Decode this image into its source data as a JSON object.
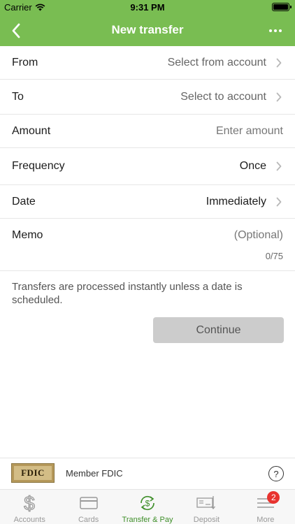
{
  "status_bar": {
    "carrier": "Carrier",
    "time": "9:31 PM"
  },
  "nav": {
    "title": "New transfer"
  },
  "form": {
    "from": {
      "label": "From",
      "value": "Select from account"
    },
    "to": {
      "label": "To",
      "value": "Select to account"
    },
    "amount": {
      "label": "Amount",
      "placeholder": "Enter amount"
    },
    "frequency": {
      "label": "Frequency",
      "value": "Once"
    },
    "date": {
      "label": "Date",
      "value": "Immediately"
    },
    "memo": {
      "label": "Memo",
      "placeholder": "(Optional)",
      "counter": "0/75"
    }
  },
  "note": "Transfers are processed instantly unless a date is scheduled.",
  "continue_label": "Continue",
  "footer": {
    "fdic_logo": "FDIC",
    "member_text": "Member FDIC",
    "help_label": "?"
  },
  "tabs": [
    {
      "label": "Accounts",
      "icon": "dollar-icon",
      "active": false
    },
    {
      "label": "Cards",
      "icon": "card-icon",
      "active": false
    },
    {
      "label": "Transfer & Pay",
      "icon": "transfer-pay-icon",
      "active": true
    },
    {
      "label": "Deposit",
      "icon": "check-deposit-icon",
      "active": false
    },
    {
      "label": "More",
      "icon": "menu-icon",
      "active": false,
      "badge": "2"
    }
  ],
  "colors": {
    "brand_green": "#79bd52",
    "active_tab": "#3f8f2a",
    "badge_red": "#e8332f",
    "button_disabled": "#cccccc"
  }
}
